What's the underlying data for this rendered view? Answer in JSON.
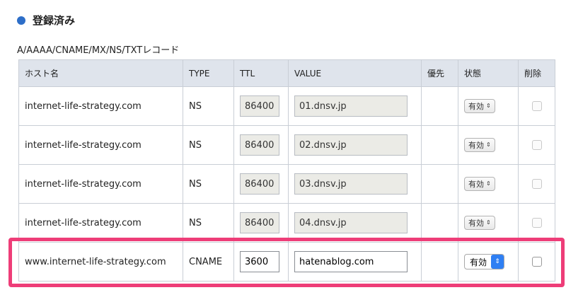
{
  "section": {
    "title": "登録済み"
  },
  "table_title": "A/AAAA/CNAME/MX/NS/TXTレコード",
  "columns": {
    "host": "ホスト名",
    "type": "TYPE",
    "ttl": "TTL",
    "value": "VALUE",
    "priority": "優先",
    "state": "状態",
    "delete": "削除"
  },
  "rows": [
    {
      "host": "internet-life-strategy.com",
      "type": "NS",
      "ttl": "86400",
      "value": "01.dnsv.jp",
      "priority": "",
      "state": "有効"
    },
    {
      "host": "internet-life-strategy.com",
      "type": "NS",
      "ttl": "86400",
      "value": "02.dnsv.jp",
      "priority": "",
      "state": "有効"
    },
    {
      "host": "internet-life-strategy.com",
      "type": "NS",
      "ttl": "86400",
      "value": "03.dnsv.jp",
      "priority": "",
      "state": "有効"
    },
    {
      "host": "internet-life-strategy.com",
      "type": "NS",
      "ttl": "86400",
      "value": "04.dnsv.jp",
      "priority": "",
      "state": "有効"
    },
    {
      "host": "www.internet-life-strategy.com",
      "type": "CNAME",
      "ttl": "3600",
      "value": "hatenablog.com",
      "priority": "",
      "state": "有効"
    }
  ],
  "colors": {
    "accent": "#2d6ec8",
    "highlight": "#ee3d78",
    "header_bg": "#dfe4ec"
  },
  "icons": {
    "bullet": "circle-bullet-icon",
    "select_arrows": "updown-arrows-icon"
  }
}
